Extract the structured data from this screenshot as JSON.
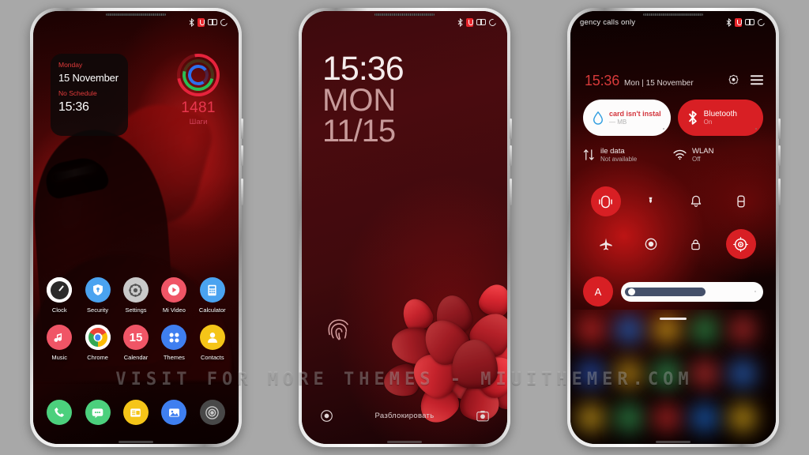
{
  "background_color": "#a8a8a8",
  "watermark": {
    "text": "VISIT FOR MORE THEMES - MIUITHEMER.COM"
  },
  "status_bar": {
    "icons": [
      "bluetooth-icon",
      "alarm-icon",
      "battery-icon",
      "sync-icon"
    ],
    "carrier_text": "gency calls only"
  },
  "phone1": {
    "label": "home-screen",
    "clock_widget": {
      "day": "Monday",
      "date": "15 November",
      "schedule": "No Schedule",
      "time": "15:36"
    },
    "steps_widget": {
      "value": "1481",
      "label": "Шаги",
      "ring_colors": [
        "#e6233c",
        "#2bbe53",
        "#2d6feb"
      ]
    },
    "apps": [
      {
        "name": "Clock",
        "icon": "clock-icon",
        "bg": "#ffffff"
      },
      {
        "name": "Security",
        "icon": "shield-icon",
        "bg": "#4aa3f0"
      },
      {
        "name": "Settings",
        "icon": "gear-icon",
        "bg": "#c9c9c9"
      },
      {
        "name": "Mi Video",
        "icon": "play-icon",
        "bg": "#f05566"
      },
      {
        "name": "Calculator",
        "icon": "calculator-icon",
        "bg": "#4aa3f0"
      },
      {
        "name": "Music",
        "icon": "music-note-icon",
        "bg": "#f05566"
      },
      {
        "name": "Chrome",
        "icon": "chrome-icon",
        "bg": "#ffffff"
      },
      {
        "name": "Calendar",
        "icon": "calendar-icon",
        "bg": "#f05566"
      },
      {
        "name": "Themes",
        "icon": "themes-icon",
        "bg": "#3f7ff0"
      },
      {
        "name": "Contacts",
        "icon": "contact-icon",
        "bg": "#f5c518"
      }
    ],
    "calendar_day": "15",
    "dock": [
      {
        "name": "Phone",
        "icon": "phone-icon",
        "bg": "#4cd07d"
      },
      {
        "name": "Messages",
        "icon": "message-icon",
        "bg": "#4cd07d"
      },
      {
        "name": "Notes",
        "icon": "notes-icon",
        "bg": "#f5c518"
      },
      {
        "name": "Gallery",
        "icon": "gallery-icon",
        "bg": "#3f7ff0"
      },
      {
        "name": "Camera",
        "icon": "camera-icon",
        "bg": "#484848"
      }
    ]
  },
  "phone2": {
    "label": "lock-screen",
    "time": "15:36",
    "weekday": "MON",
    "date": "11/15",
    "unlock_text": "Разблокировать",
    "left_icon": "assistant-circle-icon",
    "right_icon": "camera-icon",
    "fingerprint_icon": "fingerprint-icon"
  },
  "phone3": {
    "label": "notification-shade",
    "carrier": "gency calls only",
    "time": "15:36",
    "date": "Mon | 15 November",
    "header_icons": [
      "settings-icon",
      "menu-icon"
    ],
    "quick_cards": [
      {
        "title": "card isn't instal",
        "subtitle": "— MB",
        "icon": "water-drop-icon",
        "style": "white"
      },
      {
        "title": "Bluetooth",
        "subtitle": "On",
        "icon": "bluetooth-icon",
        "style": "red"
      }
    ],
    "quick_rows": [
      {
        "title": "ile data",
        "subtitle": "Not available",
        "icon": "data-arrows-icon"
      },
      {
        "title": "WLAN",
        "subtitle": "Off",
        "icon": "wifi-icon"
      }
    ],
    "toggles": [
      {
        "name": "silent-mode",
        "icon": "vibrate-icon",
        "active": true
      },
      {
        "name": "flashlight",
        "icon": "flashlight-icon",
        "active": false
      },
      {
        "name": "do-not-disturb",
        "icon": "bell-icon",
        "active": false
      },
      {
        "name": "battery-saver",
        "icon": "battery-icon",
        "active": false
      },
      {
        "name": "airplane-mode",
        "icon": "airplane-icon",
        "active": false
      },
      {
        "name": "screen-record",
        "icon": "record-icon",
        "active": false
      },
      {
        "name": "rotation-lock",
        "icon": "lock-icon",
        "active": false
      },
      {
        "name": "location",
        "icon": "location-icon",
        "active": true
      }
    ],
    "brightness": {
      "auto_label": "A",
      "level_percent": 60
    }
  }
}
